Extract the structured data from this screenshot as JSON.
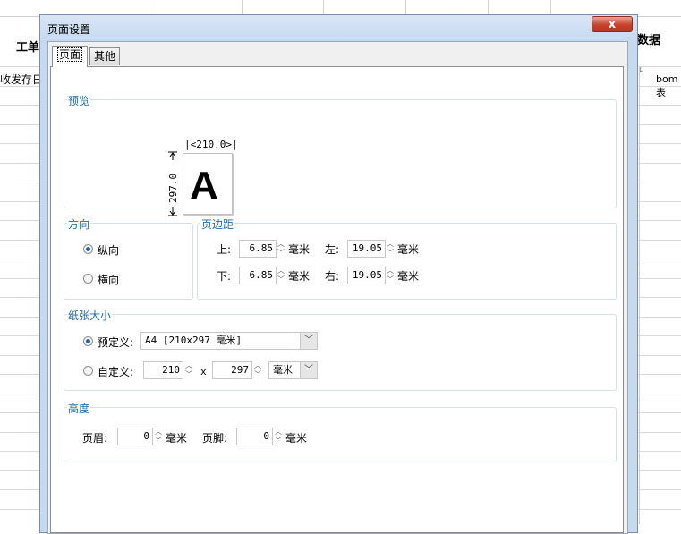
{
  "background": {
    "title_left": "工单",
    "title_right": "数据",
    "header_left": "收发存日",
    "header_right": "bom表"
  },
  "dialog": {
    "title": "页面设置",
    "close_label": "x",
    "tabs": [
      {
        "label": "页面",
        "active": true
      },
      {
        "label": "其他",
        "active": false
      }
    ],
    "preview": {
      "legend": "预览",
      "width": "210.0",
      "height": "297.0",
      "letter": "A"
    },
    "orientation": {
      "legend": "方向",
      "options": [
        {
          "label": "纵向",
          "checked": true
        },
        {
          "label": "横向",
          "checked": false
        }
      ]
    },
    "margins": {
      "legend": "页边距",
      "unit": "毫米",
      "top_label": "上:",
      "top_value": "6.85",
      "left_label": "左:",
      "left_value": "19.05",
      "bottom_label": "下:",
      "bottom_value": "6.85",
      "right_label": "右:",
      "right_value": "19.05"
    },
    "paper_size": {
      "legend": "纸张大小",
      "predefined_label": "预定义:",
      "predefined_checked": true,
      "predefined_value": "A4 [210x297 毫米]",
      "custom_label": "自定义:",
      "custom_checked": false,
      "custom_width": "210",
      "x_sep": "x",
      "custom_height": "297",
      "custom_unit": "毫米"
    },
    "height": {
      "legend": "高度",
      "header_label": "页眉:",
      "header_value": "0",
      "footer_label": "页脚:",
      "footer_value": "0",
      "unit": "毫米"
    }
  }
}
